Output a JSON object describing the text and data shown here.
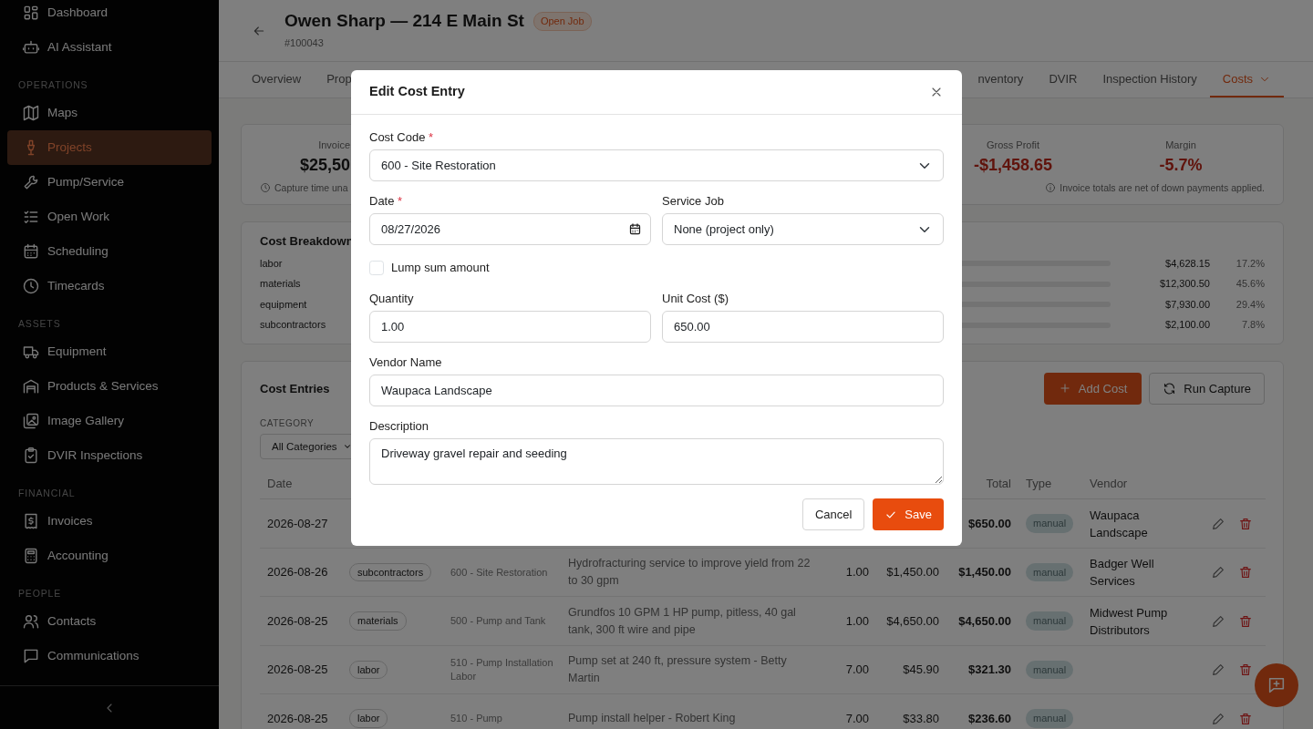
{
  "sidebar": {
    "sections": [
      {
        "items": [
          {
            "label": "Dashboard",
            "selected": false
          },
          {
            "label": "AI Assistant",
            "selected": false
          }
        ]
      },
      {
        "heading": "OPERATIONS",
        "items": [
          {
            "label": "Maps",
            "selected": false
          },
          {
            "label": "Projects",
            "selected": true
          },
          {
            "label": "Pump/Service",
            "selected": false
          },
          {
            "label": "Open Work",
            "selected": false
          },
          {
            "label": "Scheduling",
            "selected": false
          },
          {
            "label": "Timecards",
            "selected": false
          }
        ]
      },
      {
        "heading": "ASSETS",
        "items": [
          {
            "label": "Equipment",
            "selected": false
          },
          {
            "label": "Products & Services",
            "selected": false
          },
          {
            "label": "Image Gallery",
            "selected": false
          },
          {
            "label": "DVIR Inspections",
            "selected": false
          }
        ]
      },
      {
        "heading": "FINANCIAL",
        "items": [
          {
            "label": "Invoices",
            "selected": false
          },
          {
            "label": "Accounting",
            "selected": false
          }
        ]
      },
      {
        "heading": "PEOPLE",
        "items": [
          {
            "label": "Contacts",
            "selected": false
          },
          {
            "label": "Communications",
            "selected": false
          }
        ]
      }
    ]
  },
  "header": {
    "title": "Owen Sharp — 214 E Main St",
    "status": "Open Job",
    "number": "#100043"
  },
  "tabs_left": [
    {
      "label": "Overview",
      "selected": false
    },
    {
      "label": "Prop",
      "selected": false
    }
  ],
  "tabs_right": [
    {
      "label": "nventory",
      "selected": false
    },
    {
      "label": "DVIR",
      "selected": false
    },
    {
      "label": "Inspection History",
      "selected": false
    },
    {
      "label": "Costs",
      "selected": true,
      "dropdown": true
    }
  ],
  "summary": {
    "first": {
      "label": "Invoice",
      "value": "$25,50"
    },
    "metrics": [
      {
        "label": "Gross Profit",
        "value": "-$1,458.65"
      },
      {
        "label": "Margin",
        "value": "-5.7%"
      }
    ],
    "capture_note": "Capture time una",
    "invoice_note": "Invoice totals are net of down payments applied."
  },
  "breakdown": {
    "title": "Cost Breakdown",
    "rows": [
      {
        "category": "labor",
        "amount": "$4,628.15",
        "percent": "17.2%"
      },
      {
        "category": "materials",
        "amount": "$12,300.50",
        "percent": "45.6%"
      },
      {
        "category": "equipment",
        "amount": "$7,930.00",
        "percent": "29.4%"
      },
      {
        "category": "subcontractors",
        "amount": "$2,100.00",
        "percent": "7.8%"
      }
    ]
  },
  "cost_entries": {
    "title": "Cost Entries",
    "add_button": "Add Cost",
    "capture_button": "Run Capture",
    "category_label": "CATEGORY",
    "category_value": "All Categories",
    "header": {
      "date": "Date",
      "total": "Total",
      "type": "Type",
      "vendor": "Vendor"
    },
    "rows": [
      {
        "date": "2026-08-27",
        "total": "$650.00",
        "type": "manual",
        "vendor": "Waupaca Landscape"
      },
      {
        "date": "2026-08-26",
        "category": "subcontractors",
        "cost_code": "600 - Site Restoration",
        "description": "Hydrofracturing service to improve yield from 22 to 30 gpm",
        "quantity": "1.00",
        "unit_cost": "$1,450.00",
        "total": "$1,450.00",
        "type": "manual",
        "vendor": "Badger Well Services"
      },
      {
        "date": "2026-08-25",
        "category": "materials",
        "cost_code": "500 - Pump and Tank",
        "description": "Grundfos 10 GPM 1 HP pump, pitless, 40 gal tank, 300 ft wire and pipe",
        "quantity": "1.00",
        "unit_cost": "$4,650.00",
        "total": "$4,650.00",
        "type": "manual",
        "vendor": "Midwest Pump Distributors"
      },
      {
        "date": "2026-08-25",
        "category": "labor",
        "cost_code": "510 - Pump Installation Labor",
        "description": "Pump set at 240 ft, pressure system - Betty Martin",
        "quantity": "7.00",
        "unit_cost": "$45.90",
        "total": "$321.30",
        "type": "manual"
      },
      {
        "date": "2026-08-25",
        "category": "labor",
        "cost_code": "510 - Pump",
        "description": "Pump install helper - Robert King",
        "quantity": "7.00",
        "unit_cost": "$33.80",
        "total": "$236.60",
        "type": "manual"
      }
    ]
  },
  "dialog": {
    "title": "Edit Cost Entry",
    "cost_code": {
      "label": "Cost Code",
      "required_mark": "*",
      "value": "600 - Site Restoration"
    },
    "date": {
      "label": "Date",
      "required_mark": "*",
      "value": "08/27/2026"
    },
    "service_job": {
      "label": "Service Job",
      "value": "None (project only)"
    },
    "lump_sum": {
      "label": "Lump sum amount",
      "checked": false
    },
    "quantity": {
      "label": "Quantity",
      "value": "1.00"
    },
    "unit_cost": {
      "label": "Unit Cost ($)",
      "value": "650.00"
    },
    "vendor": {
      "label": "Vendor Name",
      "value": "Waupaca Landscape"
    },
    "description": {
      "label": "Description",
      "value": "Driveway gravel repair and seeding"
    },
    "cancel_button": "Cancel",
    "save_button": "Save"
  }
}
